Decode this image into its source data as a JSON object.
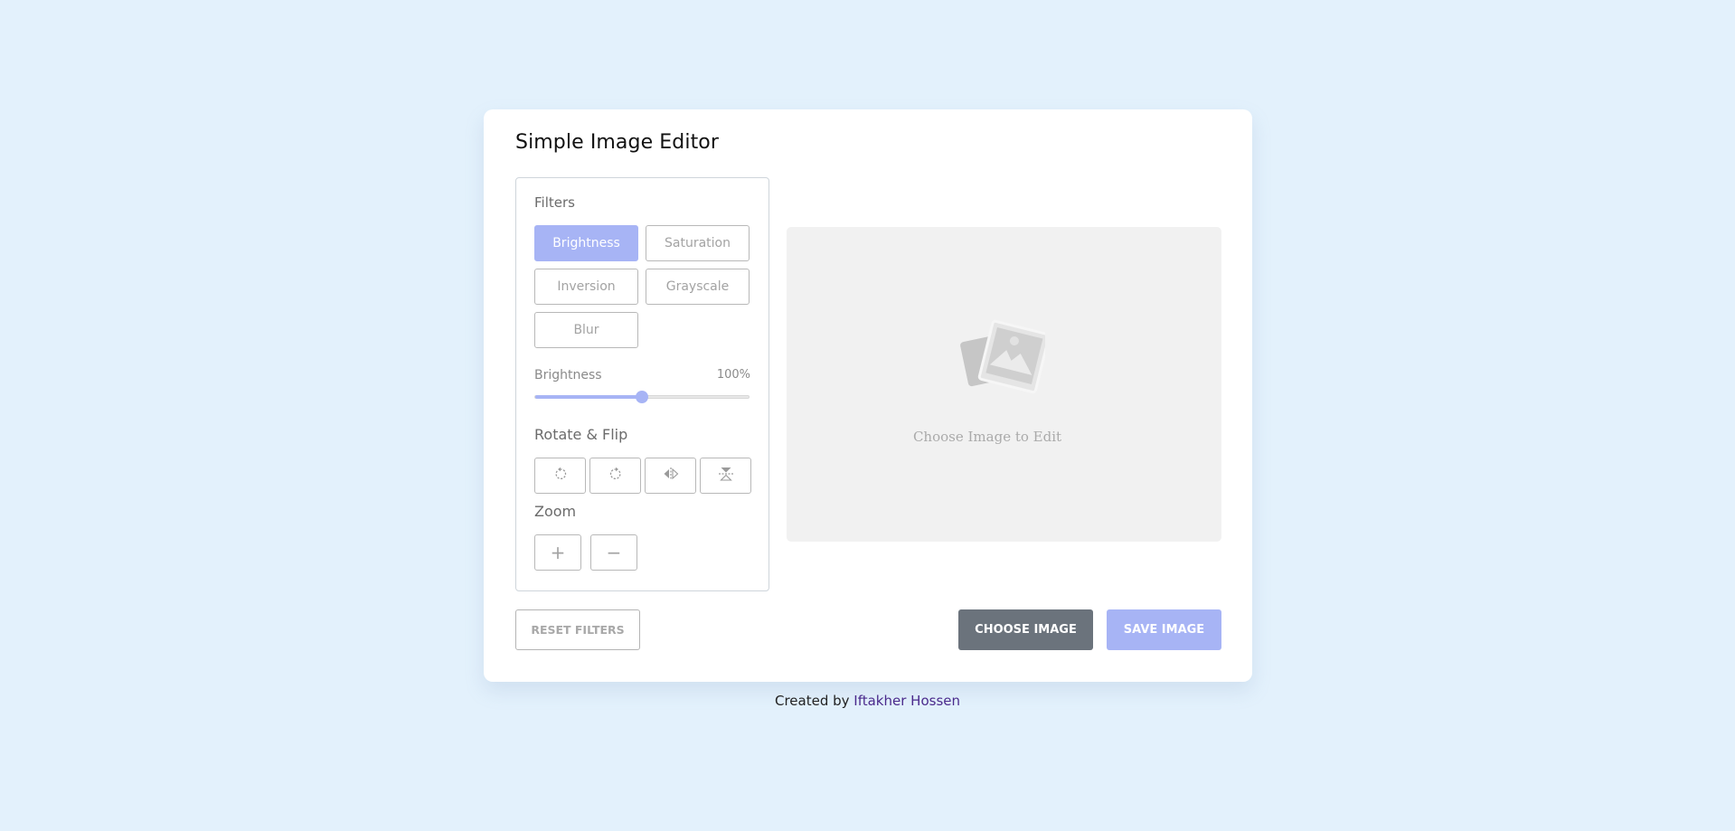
{
  "app": {
    "title": "Simple Image Editor"
  },
  "filters": {
    "heading": "Filters",
    "buttons": [
      {
        "label": "Brightness",
        "active": true
      },
      {
        "label": "Saturation",
        "active": false
      },
      {
        "label": "Inversion",
        "active": false
      },
      {
        "label": "Grayscale",
        "active": false
      },
      {
        "label": "Blur",
        "active": false
      }
    ],
    "slider": {
      "name": "Brightness",
      "value_text": "100%",
      "value_percent": 50
    }
  },
  "rotate_flip": {
    "heading": "Rotate & Flip",
    "icons": [
      "rotate-left-icon",
      "rotate-right-icon",
      "flip-horizontal-icon",
      "flip-vertical-icon"
    ]
  },
  "zoom": {
    "heading": "Zoom",
    "plus": "+",
    "minus": "−"
  },
  "preview": {
    "placeholder_text": "Choose Image to Edit",
    "icon": "image-placeholder-icon"
  },
  "actions": {
    "reset": "RESET FILTERS",
    "choose": "CHOOSE IMAGE",
    "save": "SAVE IMAGE"
  },
  "footer": {
    "prefix": "Created by",
    "author": "Iftakher Hossen"
  },
  "colors": {
    "accent": "#a7b4f5",
    "background": "#e3f1fc",
    "dark_button": "#6b737c",
    "author_link": "#4a2a8c"
  }
}
